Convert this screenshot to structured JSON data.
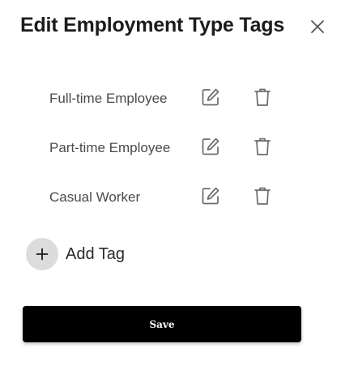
{
  "dialog": {
    "title": "Edit Employment Type Tags",
    "close_icon": "close-icon"
  },
  "tags": [
    {
      "label": "Full-time Employee",
      "edit_icon": "edit-icon",
      "delete_icon": "trash-icon"
    },
    {
      "label": "Part-time Employee",
      "edit_icon": "edit-icon",
      "delete_icon": "trash-icon"
    },
    {
      "label": "Casual Worker",
      "edit_icon": "edit-icon",
      "delete_icon": "trash-icon"
    }
  ],
  "add_tag": {
    "label": "Add Tag",
    "icon": "plus-icon"
  },
  "footer": {
    "save_label": "Save"
  },
  "colors": {
    "text_primary": "#1c1c1c",
    "text_secondary": "#4a4a4a",
    "icon_gray": "#6b6b6b",
    "add_circle_bg": "#dcdcdc",
    "save_bg": "#000000",
    "save_text": "#ffffff"
  }
}
